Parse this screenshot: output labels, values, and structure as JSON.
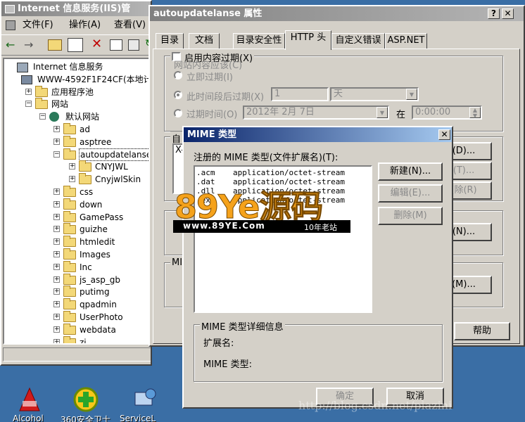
{
  "iis": {
    "title": "Internet 信息服务(IIS)管",
    "menu": [
      "文件(F)",
      "操作(A)",
      "查看(V)"
    ],
    "tree": [
      {
        "label": "Internet 信息服务",
        "level": 0,
        "icon": "iis-root-icon"
      },
      {
        "label": "WWW-4592F1F24CF(本地计算",
        "level": 1,
        "icon": "computer-icon"
      },
      {
        "label": "应用程序池",
        "level": 2,
        "icon": "folder-icon",
        "exp": "+"
      },
      {
        "label": "网站",
        "level": 2,
        "icon": "folder-icon",
        "exp": "−"
      },
      {
        "label": "默认网站",
        "level": 3,
        "icon": "globe-icon",
        "exp": "−"
      },
      {
        "label": "ad",
        "level": 4,
        "icon": "folder-icon",
        "exp": "+"
      },
      {
        "label": "asptree",
        "level": 4,
        "icon": "folder-icon",
        "exp": "+"
      },
      {
        "label": "autoupdatelanse",
        "level": 4,
        "icon": "folder-icon",
        "exp": "−",
        "selected": true
      },
      {
        "label": "CNYJWL",
        "level": 5,
        "icon": "folder-icon",
        "exp": "+"
      },
      {
        "label": "CnyjwlSkin",
        "level": 5,
        "icon": "folder-icon",
        "exp": "+"
      },
      {
        "label": "css",
        "level": 4,
        "icon": "folder-icon",
        "exp": "+"
      },
      {
        "label": "down",
        "level": 4,
        "icon": "folder-icon",
        "exp": "+"
      },
      {
        "label": "GamePass",
        "level": 4,
        "icon": "folder-icon",
        "exp": "+"
      },
      {
        "label": "guizhe",
        "level": 4,
        "icon": "folder-icon",
        "exp": "+"
      },
      {
        "label": "htmledit",
        "level": 4,
        "icon": "folder-icon",
        "exp": "+"
      },
      {
        "label": "Images",
        "level": 4,
        "icon": "folder-icon",
        "exp": "+"
      },
      {
        "label": "Inc",
        "level": 4,
        "icon": "folder-icon",
        "exp": "+"
      },
      {
        "label": "js_asp_gb",
        "level": 4,
        "icon": "folder-icon",
        "exp": "+"
      },
      {
        "label": "putimg",
        "level": 4,
        "icon": "folder-icon",
        "exp": "+"
      },
      {
        "label": "qpadmin",
        "level": 4,
        "icon": "folder-icon",
        "exp": "+"
      },
      {
        "label": "UserPhoto",
        "level": 4,
        "icon": "folder-icon",
        "exp": "+"
      },
      {
        "label": "webdata",
        "level": 4,
        "icon": "folder-icon",
        "exp": "+"
      },
      {
        "label": "zi",
        "level": 4,
        "icon": "folder-icon",
        "exp": "+"
      }
    ]
  },
  "props": {
    "title": "autoupdatelanse 属性",
    "help_btn": "?",
    "close_btn": "✕",
    "tabs": [
      "目录",
      "文档",
      "目录安全性",
      "HTTP 头",
      "自定义错误",
      "ASP.NET"
    ],
    "active_tab": "HTTP 头",
    "enable_expire": "启用内容过期(X)",
    "content_should": "网站内容应该(C)",
    "expire_now": "立即过期(I)",
    "expire_after": "此时间段后过期(X)",
    "expire_after_value": "1",
    "expire_unit": "天",
    "expire_on": "过期时间(O)",
    "expire_date": "2012年  2月  7日",
    "at_label": "在",
    "expire_time": "0:00:00",
    "custom_headers_label": "自",
    "custom_header_value": "X-",
    "btn_add_header": "(D)...",
    "btn_edit_header": "(T)...",
    "btn_delete_header": "(除(R)",
    "btn_ratings": "(N)...",
    "mime_group_label": "MIM",
    "btn_mime": "(M)...",
    "help": "帮助"
  },
  "mime": {
    "title": "MIME 类型",
    "close_btn": "✕",
    "registered_label": "注册的 MIME 类型(文件扩展名)(T):",
    "list_rows": [
      {
        "ext": ".acm",
        "type": "application/octet-stream"
      },
      {
        "ext": ".dat",
        "type": "application/octet-stream"
      },
      {
        "ext": ".dll",
        "type": "application/octet-stream"
      },
      {
        "ext": ".exe",
        "type": "application/octet-stream"
      }
    ],
    "btn_new": "新建(N)...",
    "btn_edit": "编辑(E)...",
    "btn_delete": "删除(M)",
    "details_group": "MIME 类型详细信息",
    "ext_label": "扩展名:",
    "type_label": "MIME 类型:",
    "ok": "确定",
    "cancel": "取消"
  },
  "watermark": {
    "logo_text": "89Ye源码",
    "url": "www.89YE.Com",
    "tagline": "10年老站",
    "blog_url": "http://blog.csdn.net/piazini"
  },
  "desktop": {
    "icons": [
      {
        "label": "Alcohol",
        "icon": "alcohol-icon"
      },
      {
        "label": "360安全卫士",
        "icon": "360-safe-icon"
      },
      {
        "label": "ServiceL",
        "icon": "service-icon"
      }
    ]
  },
  "colors": {
    "active_title": "#0a246a",
    "inactive_title": "#808080",
    "face": "#d4d0c8",
    "desktop": "#3a6ea5",
    "logo_orange": "#f5a21b"
  }
}
